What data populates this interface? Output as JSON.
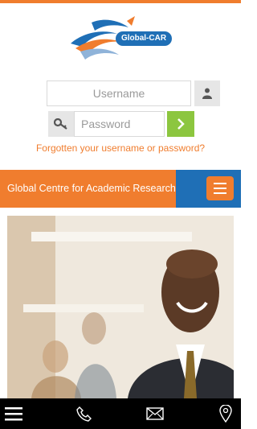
{
  "brand": {
    "logo_text": "Global-CAR"
  },
  "login": {
    "username_placeholder": "Username",
    "password_placeholder": "Password",
    "forgot_link": "Forgotten your username or password?"
  },
  "banner": {
    "title": "Global Centre for Academic Research"
  },
  "colors": {
    "accent": "#f07d2e",
    "brand_blue": "#1f6fb6",
    "go_green": "#8cc63f"
  },
  "icons": {
    "user": "user-icon",
    "key": "key-icon",
    "go": "chevron-right-icon",
    "menu": "hamburger-menu-icon",
    "bottom": [
      "menu-lines-icon",
      "phone-icon",
      "envelope-icon",
      "map-pin-icon"
    ]
  },
  "hero": {
    "alt": "smiling man in business attire"
  }
}
